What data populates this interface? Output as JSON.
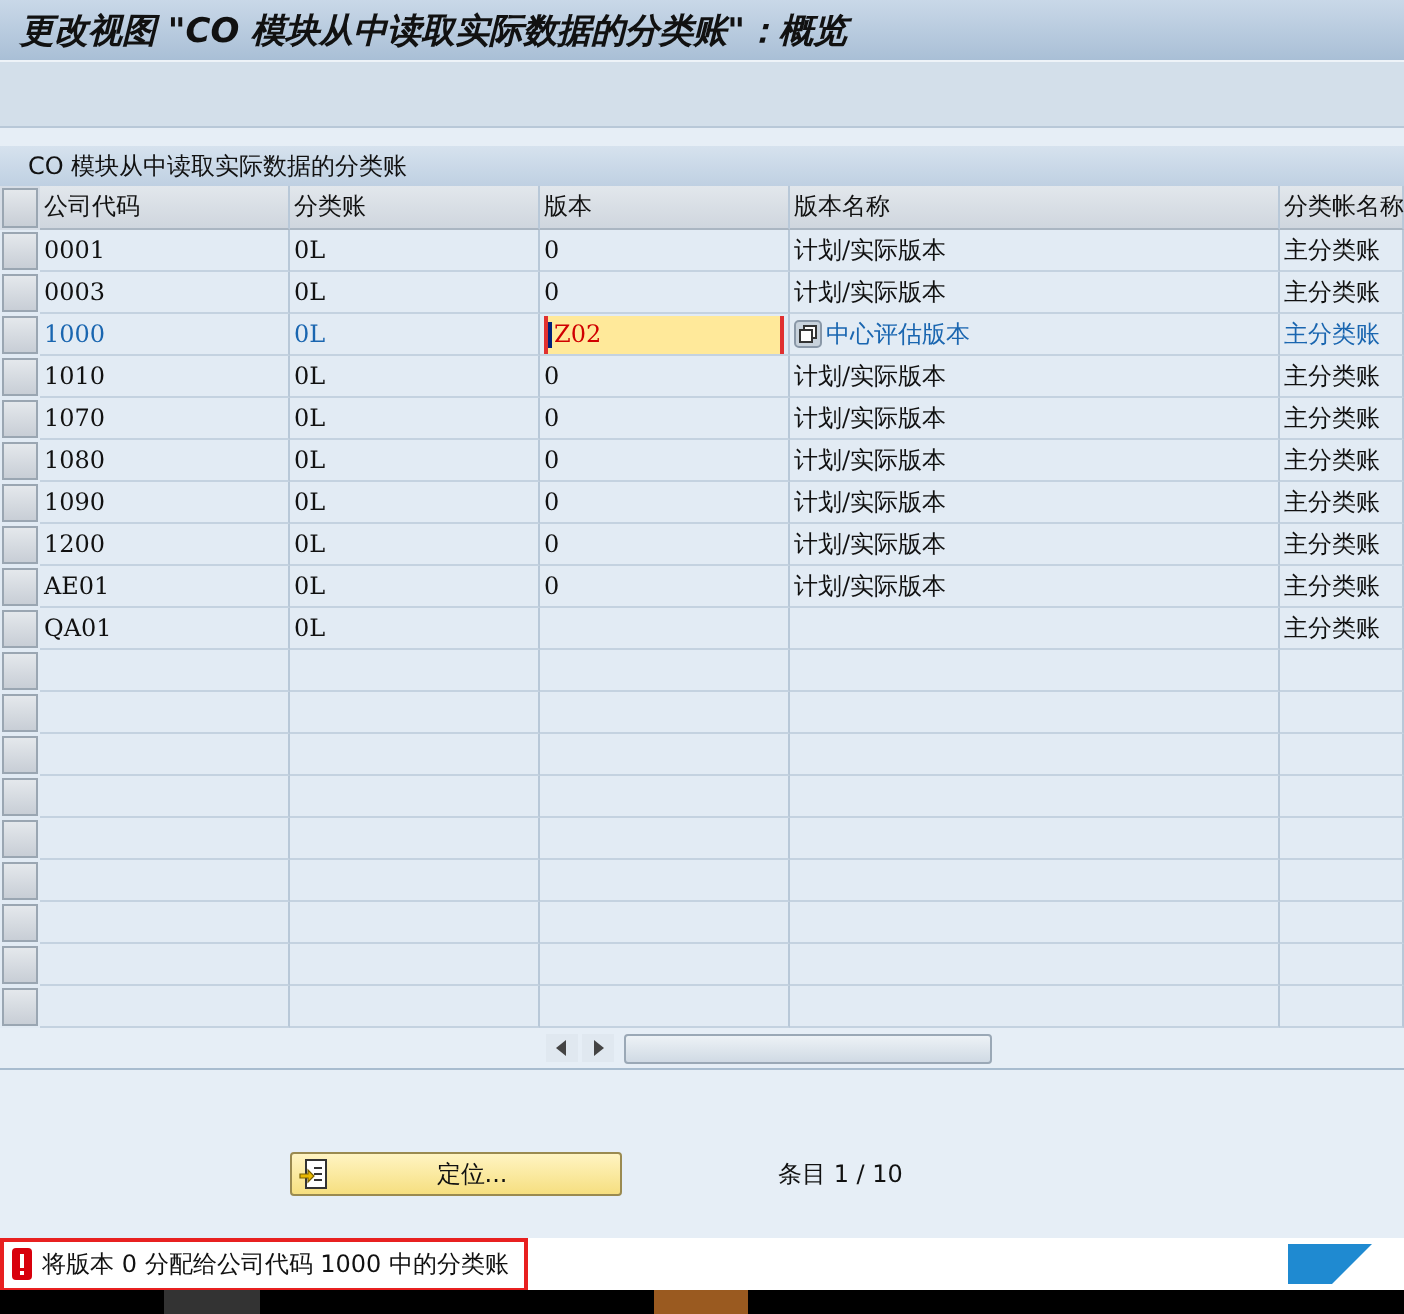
{
  "window": {
    "title": "更改视图 \"CO 模块从中读取实际数据的分类账\"：概览"
  },
  "table": {
    "title": "CO 模块从中读取实际数据的分类账",
    "columns": [
      "公司代码",
      "分类账",
      "版本",
      "版本名称",
      "分类帐名称"
    ],
    "rows": [
      {
        "cells": [
          "0001",
          "0L",
          "0",
          "计划/实际版本",
          "主分类账"
        ],
        "selected": false,
        "editing": false
      },
      {
        "cells": [
          "0003",
          "0L",
          "0",
          "计划/实际版本",
          "主分类账"
        ],
        "selected": false,
        "editing": false
      },
      {
        "cells": [
          "1000",
          "0L",
          "Z02",
          "中心评估版本",
          "主分类账"
        ],
        "selected": true,
        "editing": true
      },
      {
        "cells": [
          "1010",
          "0L",
          "0",
          "计划/实际版本",
          "主分类账"
        ],
        "selected": false,
        "editing": false
      },
      {
        "cells": [
          "1070",
          "0L",
          "0",
          "计划/实际版本",
          "主分类账"
        ],
        "selected": false,
        "editing": false
      },
      {
        "cells": [
          "1080",
          "0L",
          "0",
          "计划/实际版本",
          "主分类账"
        ],
        "selected": false,
        "editing": false
      },
      {
        "cells": [
          "1090",
          "0L",
          "0",
          "计划/实际版本",
          "主分类账"
        ],
        "selected": false,
        "editing": false
      },
      {
        "cells": [
          "1200",
          "0L",
          "0",
          "计划/实际版本",
          "主分类账"
        ],
        "selected": false,
        "editing": false
      },
      {
        "cells": [
          "AE01",
          "0L",
          "0",
          "计划/实际版本",
          "主分类账"
        ],
        "selected": false,
        "editing": false
      },
      {
        "cells": [
          "QA01",
          "0L",
          "",
          "",
          "主分类账"
        ],
        "selected": false,
        "editing": false
      }
    ]
  },
  "position_button": "定位...",
  "entry_count": "条目 1 / 10",
  "status_bar": {
    "error": true,
    "message": "将版本 0 分配给公司代码 1000 中的分类账"
  }
}
